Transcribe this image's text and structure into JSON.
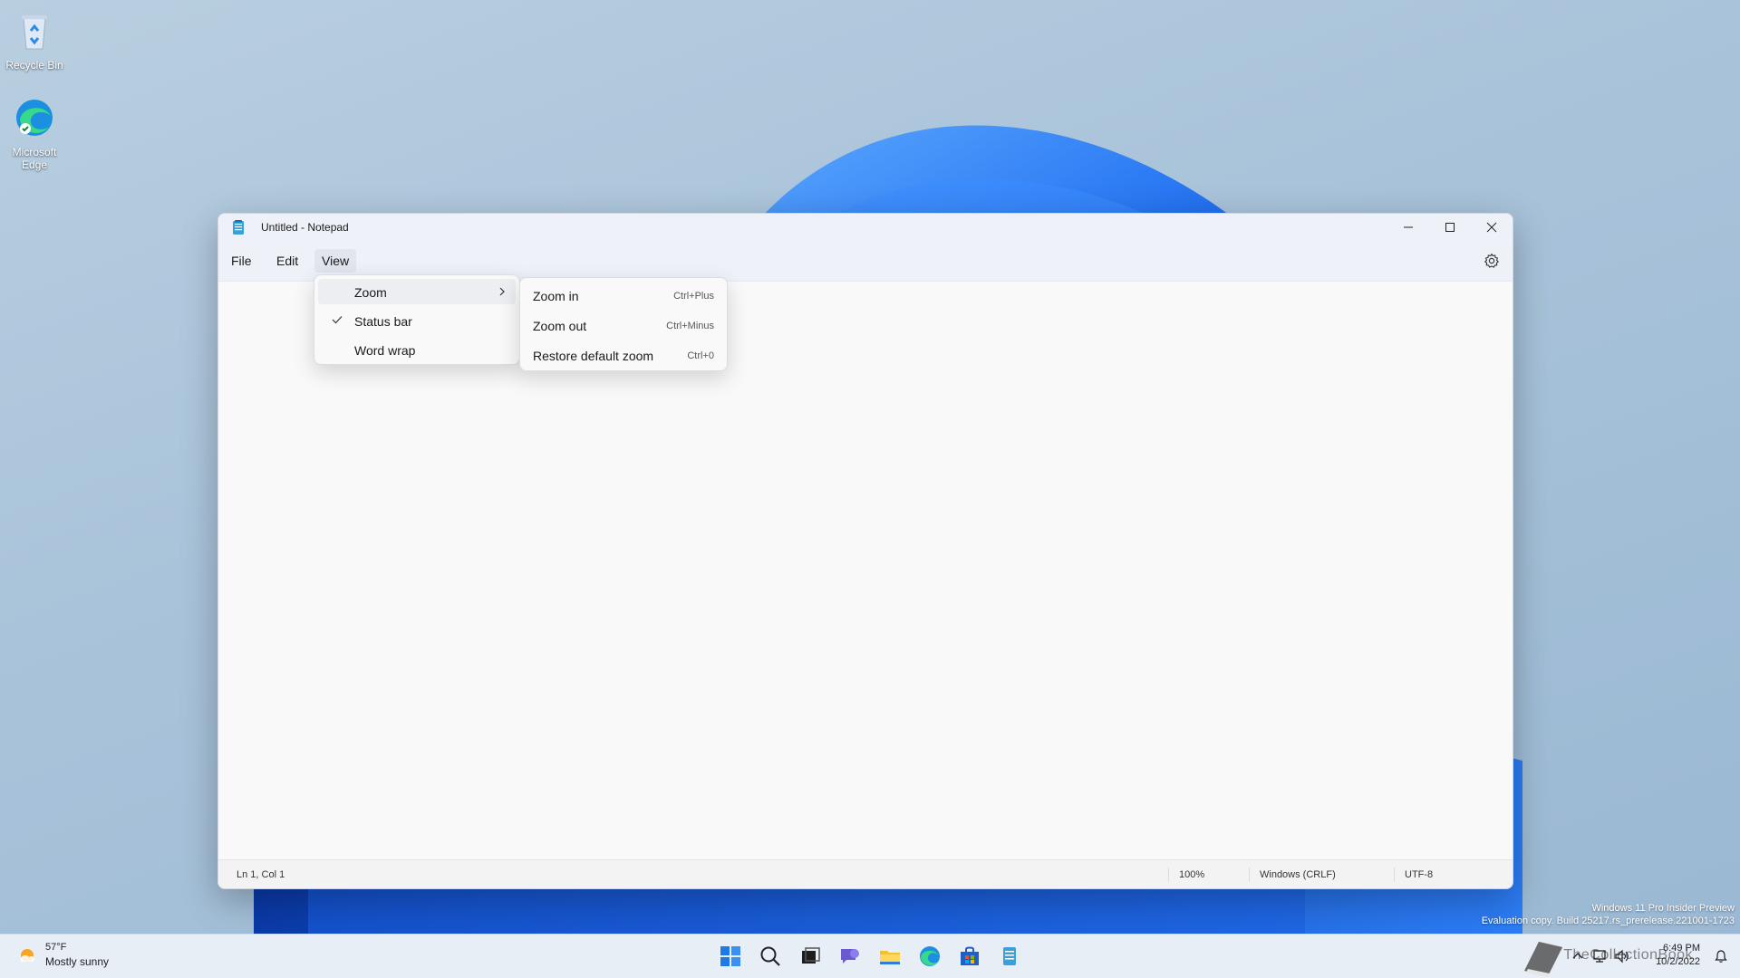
{
  "desktop": {
    "icons": [
      {
        "label": "Recycle Bin"
      },
      {
        "label": "Microsoft Edge"
      }
    ]
  },
  "window": {
    "title": "Untitled - Notepad",
    "menus": [
      {
        "label": "File"
      },
      {
        "label": "Edit"
      },
      {
        "label": "View"
      }
    ],
    "view_menu": {
      "items": [
        {
          "label": "Zoom"
        },
        {
          "label": "Status bar"
        },
        {
          "label": "Word wrap"
        }
      ]
    },
    "zoom_submenu": {
      "items": [
        {
          "label": "Zoom in",
          "shortcut": "Ctrl+Plus"
        },
        {
          "label": "Zoom out",
          "shortcut": "Ctrl+Minus"
        },
        {
          "label": "Restore default zoom",
          "shortcut": "Ctrl+0"
        }
      ]
    },
    "statusbar": {
      "position": "Ln 1, Col 1",
      "zoom": "100%",
      "line_ending": "Windows (CRLF)",
      "encoding": "UTF-8"
    }
  },
  "watermark": {
    "line1": "Windows 11 Pro Insider Preview",
    "line2": "Evaluation copy. Build 25217.rs_prerelease.221001-1723"
  },
  "taskbar": {
    "weather": {
      "temp": "57°F",
      "condition": "Mostly sunny"
    },
    "clock": {
      "time": "6:49 PM",
      "date": "10/2/2022"
    },
    "brand": "TheCollectionBook"
  },
  "colors": {
    "accent": "#2b6fd6",
    "window_bg": "#f9f9f9",
    "titlebar_bg": "#eef2f8"
  }
}
